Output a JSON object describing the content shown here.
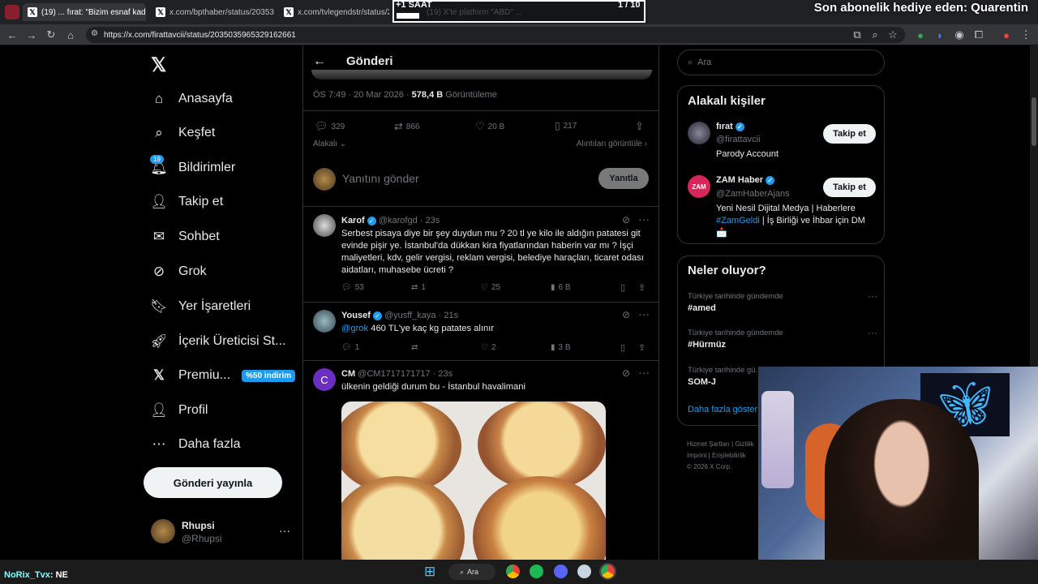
{
  "browser": {
    "tabs": [
      {
        "title": "(19) ... fırat: \"Bizim esnaf kad..."
      },
      {
        "title": "x.com/bpthaber/status/20353..."
      },
      {
        "title": "x.com/tvlegendstr/status/2035..."
      },
      {
        "title": "(19) X'te platform \"ABD\" ..."
      }
    ],
    "url": "https://x.com/firattavcii/status/2035035965329162661"
  },
  "overlay": {
    "timer": "+1 SAAT",
    "counter": "1 / 10",
    "sub_alert": "Son abonelik hediye eden: Quarentin",
    "chat_user": "NoRix_Tvx",
    "chat_msg": ": NE"
  },
  "sidebar": {
    "nav": [
      {
        "label": "Anasayfa",
        "icon": "home"
      },
      {
        "label": "Keşfet",
        "icon": "search"
      },
      {
        "label": "Bildirimler",
        "icon": "bell",
        "badge": "19"
      },
      {
        "label": "Takip et",
        "icon": "person-add"
      },
      {
        "label": "Sohbet",
        "icon": "mail"
      },
      {
        "label": "Grok",
        "icon": "grok"
      },
      {
        "label": "Yer İşaretleri",
        "icon": "bookmark"
      },
      {
        "label": "İçerik Üreticisi St...",
        "icon": "rocket"
      },
      {
        "label": "Premiu...",
        "icon": "x",
        "badge": "%50 indirim"
      },
      {
        "label": "Profil",
        "icon": "person"
      },
      {
        "label": "Daha fazla",
        "icon": "more"
      }
    ],
    "post_button": "Gönderi yayınla",
    "account": {
      "name": "Rhupsi",
      "handle": "@Rhupsi",
      "more": "···"
    }
  },
  "main": {
    "header": "Gönderi",
    "post_meta": {
      "time": "ÖS 7:49 · 20 Mar 2026 · ",
      "views": "578,4 B",
      "views_label": " Görüntüleme"
    },
    "stats": {
      "replies": "329",
      "reposts": "866",
      "likes": "20 B",
      "bookmarks": "217"
    },
    "sort": "Alakalı",
    "quotes_link": "Alıntıları görüntüle",
    "reply_box": {
      "placeholder": "Yanıtını gönder",
      "button": "Yanıtla"
    },
    "replies": [
      {
        "name": "Karof",
        "handle": "@karofgd",
        "time": "· 23s",
        "text": "Serbest pisaya diye bir şey duydun mu ? 20 tl ye kilo ile aldığın patatesi git evinde pişir ye. İstanbul'da dükkan kira fiyatlarından haberin var mı ? İşçi maliyetleri, kdv, gelir vergisi, reklam vergisi, belediye haraçları, ticaret odası aidatları, muhasebe ücreti ?",
        "stats": {
          "replies": "53",
          "reposts": "1",
          "likes": "25",
          "views": "6 B"
        }
      },
      {
        "name": "Yousef",
        "handle": "@yusff_kaya",
        "time": "· 21s",
        "mention": "@grok",
        "text": " 460 TL'ye kaç kg patates alınır",
        "stats": {
          "replies": "1",
          "reposts": "",
          "likes": "2",
          "views": "3 B"
        }
      },
      {
        "name": "CM",
        "handle": "@CM1717171717",
        "time": "· 23s",
        "text": "ülkenin geldiği durum bu - İstanbul havalimani"
      }
    ]
  },
  "right": {
    "search_placeholder": "Ara",
    "relevant": {
      "title": "Alakalı kişiler",
      "people": [
        {
          "name": "fırat",
          "handle": "@firattavcii",
          "bio": "Parody Account",
          "follow": "Takip et"
        },
        {
          "name": "ZAM Haber",
          "handle": "@ZamHaberAjans",
          "bio_a": "Yeni Nesil Dijital Medya | Haberlere ",
          "bio_tag": "#ZamGeldi",
          "bio_b": " | İş Birliği ve İhbar için DM 📩",
          "follow": "Takip et"
        }
      ]
    },
    "trends": {
      "title": "Neler oluyor?",
      "items": [
        {
          "context": "Türkiye tarihinde gündemde",
          "name": "#amed"
        },
        {
          "context": "Türkiye tarihinde gündemde",
          "name": "#Hürmüz"
        },
        {
          "context": "Türkiye tarihinde gü...",
          "name": "SOM-J"
        }
      ],
      "more": "Daha fazla göster"
    },
    "footer": [
      "Hizmet Şartları",
      "Gizlilik",
      "Imprint",
      "Erişilebilirlik",
      "© 2026 X Corp."
    ]
  },
  "taskbar": {
    "search": "Ara"
  },
  "colors": {
    "accent": "#1d9bf0",
    "bg": "#000000",
    "border": "#2f3336",
    "muted": "#71767b"
  }
}
